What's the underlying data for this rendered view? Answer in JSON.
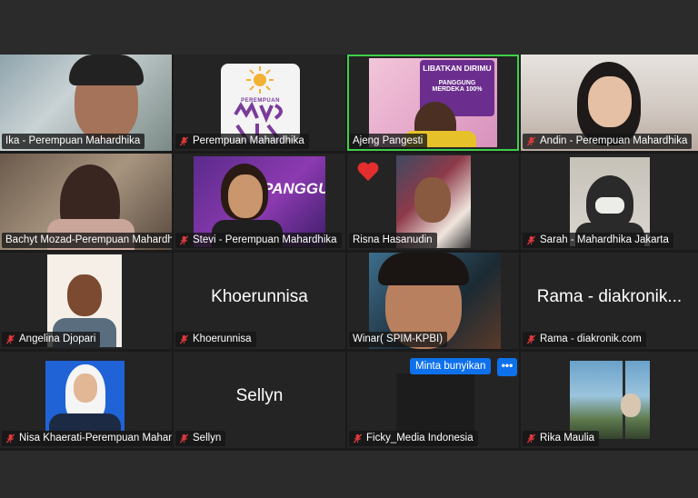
{
  "participants": [
    {
      "name": "Ika - Perempuan Mahardhika",
      "muted": false
    },
    {
      "name": "Perempuan Mahardhika",
      "muted": true,
      "logo_text": "PEREMPUAN"
    },
    {
      "name": "Ajeng Pangesti",
      "muted": false,
      "speaking": true,
      "slide_title": "LIBATKAN DIRIMU",
      "slide_sub": "PANGGUNG MERDEKA 100%"
    },
    {
      "name": "Andin - Perempuan Mahardhika",
      "muted": true
    },
    {
      "name": "Bachyt Mozad-Perempuan Mahardhika",
      "muted": false
    },
    {
      "name": "Stevi - Perempuan Mahardhika",
      "muted": true,
      "banner_text": "PANGGUNG"
    },
    {
      "name": "Risna Hasanudin",
      "muted": false,
      "reaction": "heart"
    },
    {
      "name": "Sarah - Mahardhika Jakarta",
      "muted": true
    },
    {
      "name": "Angelina Djopari",
      "muted": true
    },
    {
      "name": "Khoerunnisa",
      "muted": true,
      "display_name": "Khoerunnisa"
    },
    {
      "name": "Winar( SPIM-KPBI)",
      "muted": false
    },
    {
      "name": "Rama - diakronik.com",
      "muted": true,
      "display_name": "Rama - diakronik..."
    },
    {
      "name": "Nisa Khaerati-Perempuan Mahardhika",
      "muted": true
    },
    {
      "name": "Sellyn",
      "muted": true,
      "display_name": "Sellyn"
    },
    {
      "name": "Ficky_Media Indonesia",
      "muted": true
    },
    {
      "name": "Rika Maulia",
      "muted": true
    }
  ],
  "controls": {
    "request_unmute_label": "Minta bunyikan",
    "more_label": "•••"
  },
  "colors": {
    "active_speaker": "#3ecf4a",
    "muted_icon": "#e0393e",
    "button": "#0e71eb"
  }
}
